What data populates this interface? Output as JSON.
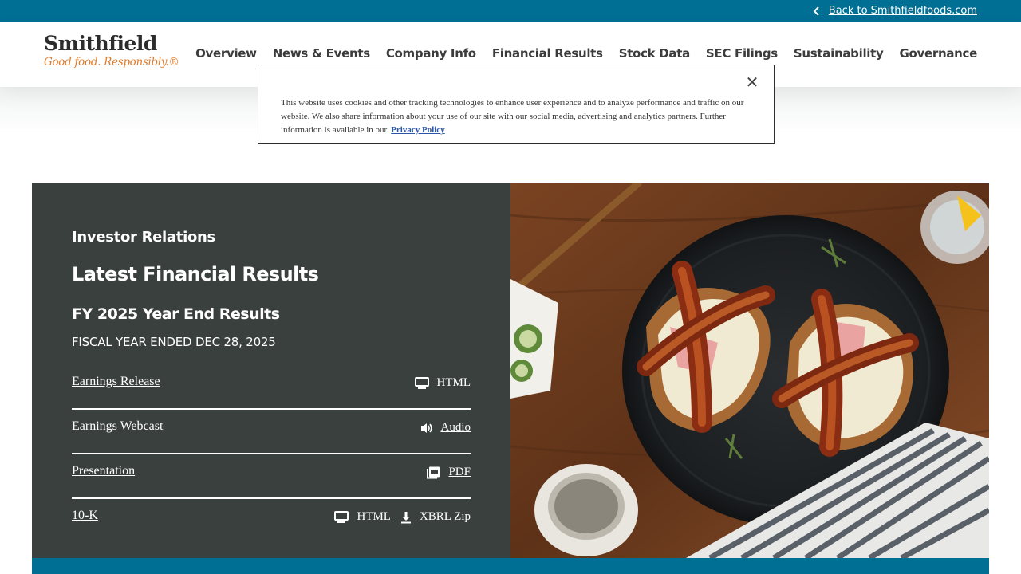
{
  "topbar": {
    "back_label": "Back to Smithfieldfoods.com"
  },
  "logo": {
    "wordmark": "Smithfield",
    "tagline": "Good food. Responsibly.®"
  },
  "nav": {
    "items": [
      "Overview",
      "News & Events",
      "Company Info",
      "Financial Results",
      "Stock Data",
      "SEC Filings",
      "Sustainability",
      "Governance"
    ]
  },
  "cookie_banner": {
    "text": "This website uses cookies and other tracking technologies to enhance user experience and to analyze performance and traffic on our website. We also share information about your use of our site with our social media, advertising and analytics partners. Further information is available in our",
    "link": "Privacy Policy",
    "close_icon": "close-icon"
  },
  "hero": {
    "eyebrow": "Investor Relations",
    "title": "Latest Financial Results",
    "subtitle": "FY 2025 Year End Results",
    "period": "FISCAL YEAR ENDED DEC 28, 2025",
    "rows": [
      {
        "label": "Earnings Release",
        "links": [
          {
            "icon": "monitor-icon",
            "text": "HTML"
          }
        ]
      },
      {
        "label": "Earnings Webcast",
        "links": [
          {
            "icon": "speaker-icon",
            "text": "Audio"
          }
        ]
      },
      {
        "label": "Presentation",
        "links": [
          {
            "icon": "pdf-icon",
            "text": "PDF"
          }
        ]
      },
      {
        "label": "10-K",
        "links": [
          {
            "icon": "monitor-icon",
            "text": "HTML"
          },
          {
            "icon": "download-icon",
            "text": "XBRL Zip"
          }
        ]
      }
    ]
  },
  "colors": {
    "brand_blue": "#006f94",
    "panel_dark": "#3a403e",
    "tagline_orange": "#e07b2a"
  }
}
